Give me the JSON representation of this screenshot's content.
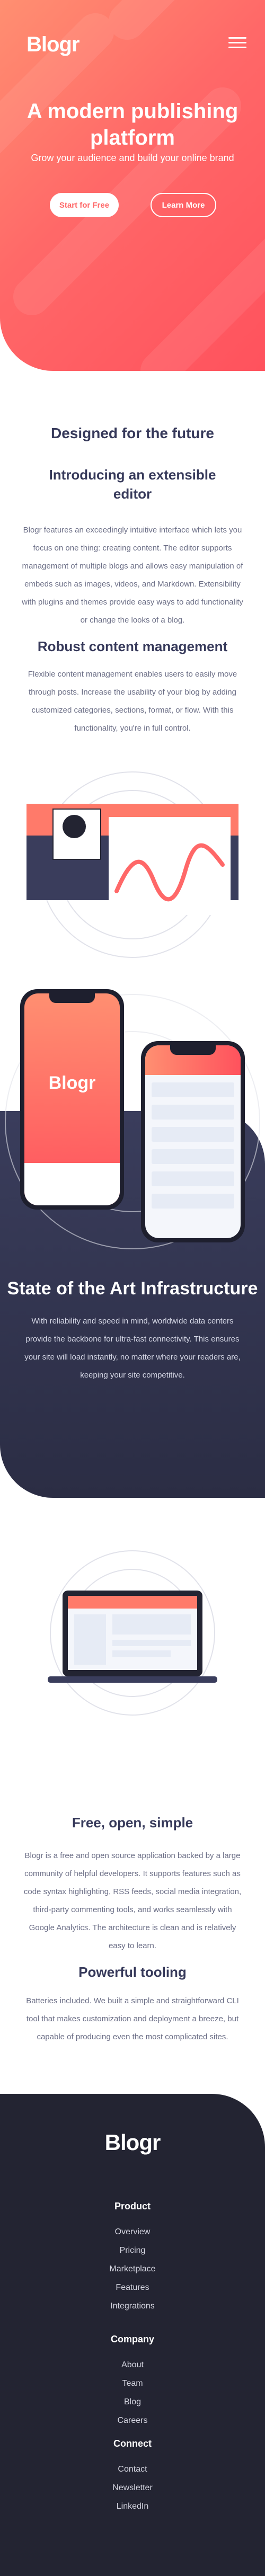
{
  "header": {
    "logo": "Blogr",
    "menu_icon": "hamburger-menu-icon"
  },
  "hero": {
    "title": "A modern publishing platform",
    "tagline": "Grow your audience and build your online brand",
    "primary_button": "Start for Free",
    "secondary_button": "Learn More"
  },
  "future": {
    "title": "Designed for the future",
    "editor_title": "Introducing an extensible editor",
    "editor_text": "Blogr features an exceedingly intuitive interface which lets you focus on one thing: creating content. The editor supports management of multiple blogs and allows easy manipulation of embeds such as images, videos, and Markdown. Extensibility with plugins and themes provide easy ways to add functionality or change the looks of a blog.",
    "content_title": "Robust content management",
    "content_text": "Flexible content management enables users to easily move through posts. Increase the usability of your blog by adding customized categories, sections, format, or flow. With this functionality, you're in full control."
  },
  "state": {
    "phone_logo": "Blogr",
    "title": "State of the Art Infrastructure",
    "text": "With reliability and speed in mind, worldwide data centers provide the backbone for ultra-fast connectivity. This ensures your site will load instantly, no matter where your readers are, keeping your site competitive."
  },
  "free": {
    "title": "Free, open, simple",
    "text": "Blogr is a free and open source application backed by a large community of helpful developers. It supports features such as code syntax highlighting, RSS feeds, social media integration, third-party commenting tools, and works seamlessly with Google Analytics. The architecture is clean and is relatively easy to learn.",
    "tooling_title": "Powerful tooling",
    "tooling_text": "Batteries included. We built a simple and straightforward CLI tool that makes customization and deployment a breeze, but capable of producing even the most complicated sites."
  },
  "footer": {
    "logo": "Blogr",
    "groups": [
      {
        "title": "Product",
        "links": [
          "Overview",
          "Pricing",
          "Marketplace",
          "Features",
          "Integrations"
        ]
      },
      {
        "title": "Company",
        "links": [
          "About",
          "Team",
          "Blog",
          "Careers"
        ]
      },
      {
        "title": "Connect",
        "links": [
          "Contact",
          "Newsletter",
          "LinkedIn"
        ]
      }
    ]
  },
  "colors": {
    "accent": "#ff6868",
    "dark": "#232432",
    "heading": "#36395a",
    "body_text": "#6b6e86"
  }
}
